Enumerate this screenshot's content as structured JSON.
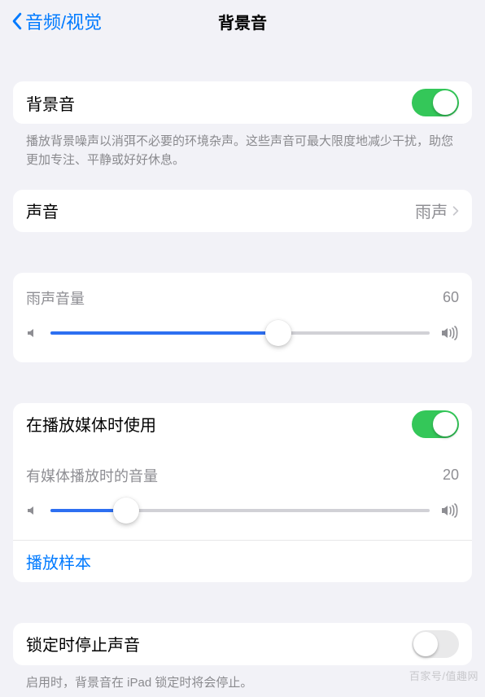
{
  "nav": {
    "back_label": "音频/视觉",
    "title": "背景音"
  },
  "main_toggle": {
    "label": "背景音",
    "on": true,
    "footer": "播放背景噪声以消弭不必要的环境杂声。这些声音可最大限度地减少干扰，助您更加专注、平静或好好休息。"
  },
  "sound": {
    "label": "声音",
    "value": "雨声"
  },
  "volume": {
    "label": "雨声音量",
    "value": 60
  },
  "media": {
    "use_label": "在播放媒体时使用",
    "use_on": true,
    "vol_label": "有媒体播放时的音量",
    "vol_value": 20,
    "sample_label": "播放样本"
  },
  "lock": {
    "label": "锁定时停止声音",
    "on": false,
    "footer": "启用时，背景音在 iPad 锁定时将会停止。"
  },
  "watermark": "百家号/值趣网"
}
